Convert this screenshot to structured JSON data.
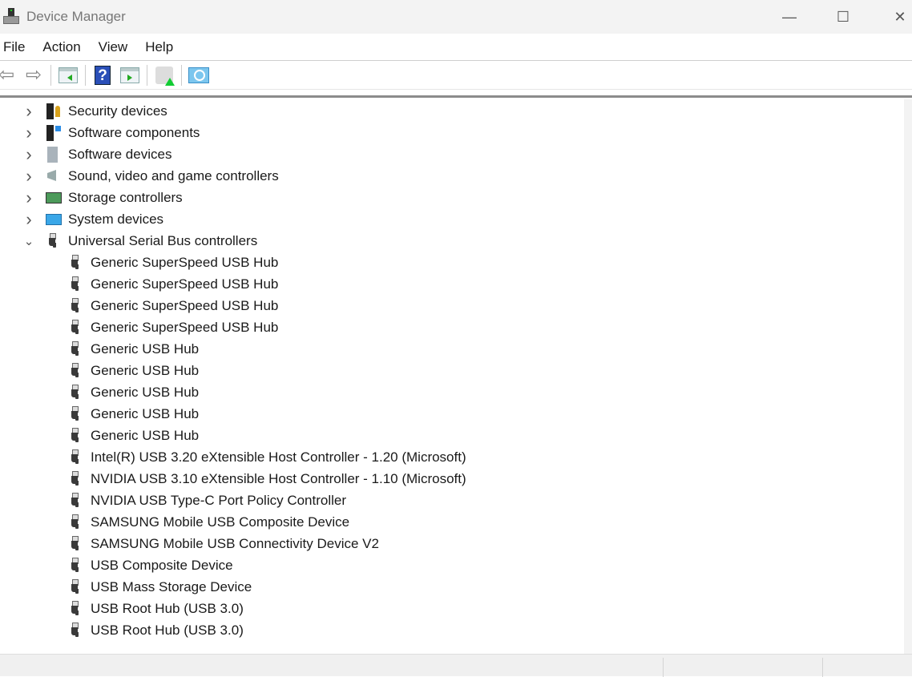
{
  "window": {
    "title": "Device Manager",
    "minimize": "—",
    "maximize": "☐",
    "close": "✕"
  },
  "menu": [
    "File",
    "Action",
    "View",
    "Help"
  ],
  "toolbar": {
    "back": "⇦",
    "forward": "⇨",
    "help": "?"
  },
  "tree": {
    "categories": [
      {
        "label": "Security devices",
        "icon": "ic-sec",
        "iconName": "security-devices-icon",
        "expanded": false
      },
      {
        "label": "Software components",
        "icon": "ic-swc",
        "iconName": "software-components-icon",
        "expanded": false
      },
      {
        "label": "Software devices",
        "icon": "ic-swd",
        "iconName": "software-devices-icon",
        "expanded": false
      },
      {
        "label": "Sound, video and game controllers",
        "icon": "ic-snd",
        "iconName": "speaker-icon",
        "expanded": false
      },
      {
        "label": "Storage controllers",
        "icon": "ic-sto",
        "iconName": "storage-controller-icon",
        "expanded": false
      },
      {
        "label": "System devices",
        "icon": "ic-sys",
        "iconName": "system-devices-icon",
        "expanded": false
      },
      {
        "label": "Universal Serial Bus controllers",
        "icon": "usb",
        "iconName": "usb-icon",
        "expanded": true
      }
    ],
    "usb_devices": [
      "Generic SuperSpeed USB Hub",
      "Generic SuperSpeed USB Hub",
      "Generic SuperSpeed USB Hub",
      "Generic SuperSpeed USB Hub",
      "Generic USB Hub",
      "Generic USB Hub",
      "Generic USB Hub",
      "Generic USB Hub",
      "Generic USB Hub",
      "Intel(R) USB 3.20 eXtensible Host Controller - 1.20 (Microsoft)",
      "NVIDIA USB 3.10 eXtensible Host Controller - 1.10 (Microsoft)",
      "NVIDIA USB Type-C Port Policy Controller",
      "SAMSUNG Mobile USB Composite Device",
      "SAMSUNG Mobile USB Connectivity Device V2",
      "USB Composite Device",
      "USB Mass Storage Device",
      "USB Root Hub (USB 3.0)",
      "USB Root Hub (USB 3.0)"
    ],
    "chevron_collapsed": "›",
    "chevron_expanded": "⌄"
  }
}
